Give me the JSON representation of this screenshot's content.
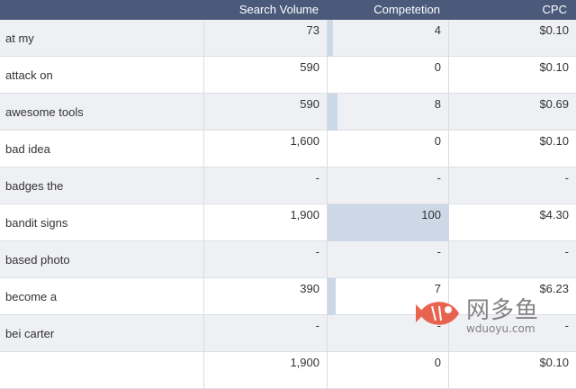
{
  "header": {
    "keyword": "",
    "search_volume": "Search Volume",
    "competition": "Competetion",
    "cpc": "CPC"
  },
  "rows": [
    {
      "keyword": "at my",
      "volume": "73",
      "competition": "4",
      "comp_level": 0.04,
      "cpc": "$0.10"
    },
    {
      "keyword": "attack on",
      "volume": "590",
      "competition": "0",
      "comp_level": 0.0,
      "cpc": "$0.10"
    },
    {
      "keyword": "awesome tools",
      "volume": "590",
      "competition": "8",
      "comp_level": 0.08,
      "cpc": "$0.69"
    },
    {
      "keyword": "bad idea",
      "volume": "1,600",
      "competition": "0",
      "comp_level": 0.0,
      "cpc": "$0.10"
    },
    {
      "keyword": "badges the",
      "volume": "-",
      "competition": "-",
      "comp_level": 0.0,
      "cpc": "-"
    },
    {
      "keyword": "bandit signs",
      "volume": "1,900",
      "competition": "100",
      "comp_level": 1.0,
      "cpc": "$4.30"
    },
    {
      "keyword": "based photo",
      "volume": "-",
      "competition": "-",
      "comp_level": 0.0,
      "cpc": "-"
    },
    {
      "keyword": "become a",
      "volume": "390",
      "competition": "7",
      "comp_level": 0.07,
      "cpc": "$6.23"
    },
    {
      "keyword": "bei carter",
      "volume": "-",
      "competition": "-",
      "comp_level": 0.0,
      "cpc": "-"
    },
    {
      "keyword": "",
      "volume": "1,900",
      "competition": "0",
      "comp_level": 0.0,
      "cpc": "$0.10"
    }
  ],
  "watermark": {
    "title": "网多鱼",
    "subtitle": "wduoyu.com",
    "color": "#e8533f"
  }
}
